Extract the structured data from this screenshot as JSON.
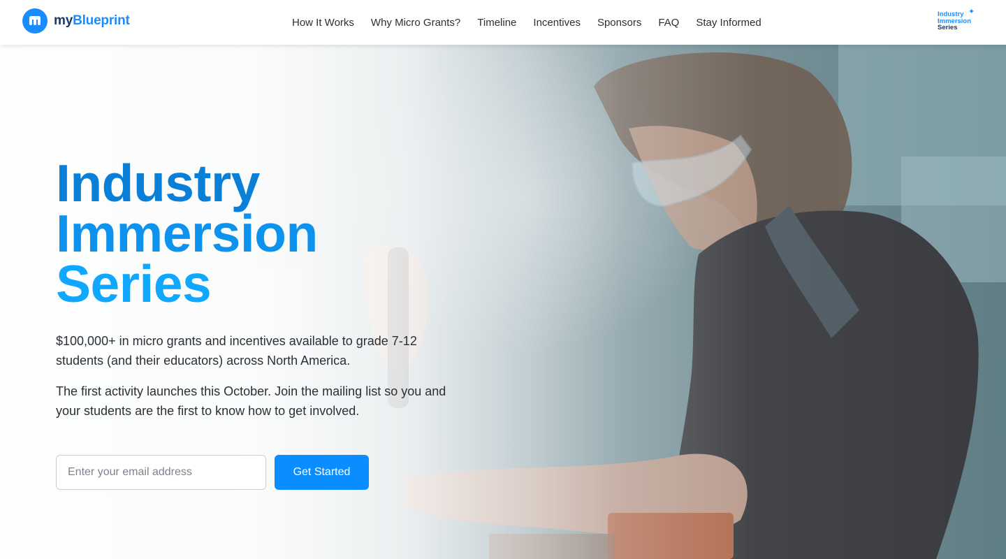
{
  "header": {
    "brand": {
      "prefix": "my",
      "name": "Blueprint",
      "icon": "blueprint-m-logo-icon"
    },
    "nav": [
      {
        "label": "How It Works"
      },
      {
        "label": "Why Micro Grants?"
      },
      {
        "label": "Timeline"
      },
      {
        "label": "Incentives"
      },
      {
        "label": "Sponsors"
      },
      {
        "label": "FAQ"
      },
      {
        "label": "Stay Informed"
      }
    ],
    "series_logo": {
      "line1": "Industry",
      "line2": "Immersion",
      "line3": "Series",
      "mark": "✦"
    }
  },
  "hero": {
    "title": {
      "line1": "Industry",
      "line2": "Immersion",
      "line3": "Series"
    },
    "paragraph1": "$100,000+ in micro grants and incentives available to grade 7-12 students (and their educators) across North America.",
    "paragraph2": "The first activity launches this October. Join the mailing list so you and your students are the first to know how to get involved.",
    "email": {
      "placeholder": "Enter your email address",
      "value": ""
    },
    "cta_label": "Get Started"
  },
  "colors": {
    "brand_blue": "#1a8cff",
    "brand_navy": "#1c3a66",
    "cta_blue": "#0a8dff",
    "title_gradient": [
      "#0a7fd8",
      "#0d92ee",
      "#10a8ff"
    ]
  }
}
